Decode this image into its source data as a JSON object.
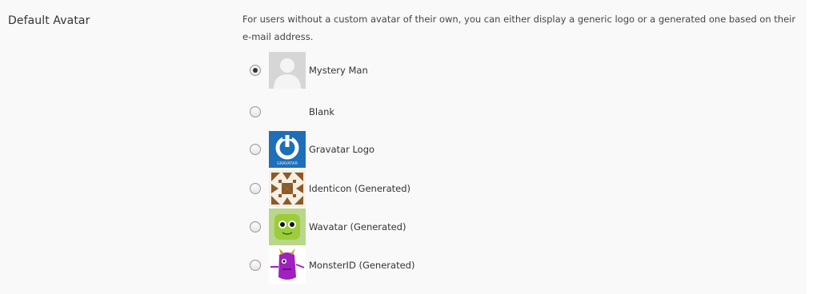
{
  "setting": {
    "label": "Default Avatar",
    "description": "For users without a custom avatar of their own, you can either display a generic logo or a generated one based on their e-mail address."
  },
  "options": [
    {
      "label": "Mystery Man",
      "icon": "mystery-man-avatar-icon",
      "checked": true
    },
    {
      "label": "Blank",
      "icon": "blank-avatar-icon",
      "checked": false
    },
    {
      "label": "Gravatar Logo",
      "icon": "gravatar-logo-icon",
      "checked": false
    },
    {
      "label": "Identicon (Generated)",
      "icon": "identicon-avatar-icon",
      "checked": false
    },
    {
      "label": "Wavatar (Generated)",
      "icon": "wavatar-avatar-icon",
      "checked": false
    },
    {
      "label": "MonsterID (Generated)",
      "icon": "monsterid-avatar-icon",
      "checked": false
    }
  ],
  "gravatar_logo_caption": "GRAVATAR",
  "colors": {
    "panel_background": "#f9f9f9",
    "gravatar_blue": "#1e6fb8",
    "identicon_brown": "#8a5a2b",
    "wavatar_green": "#9ccc3a",
    "monster_purple": "#a020c0"
  }
}
